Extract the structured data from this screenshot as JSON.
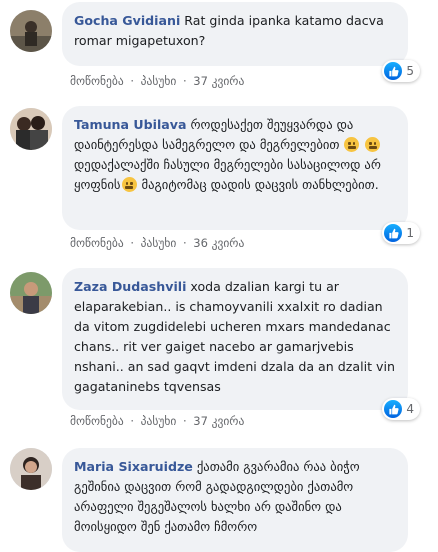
{
  "comments": [
    {
      "author": "Gocha Gvidiani",
      "text": "Rat ginda ipanka katamo dacva romar migapetuxon?",
      "like": "მოწონება",
      "reply": "პასუხი",
      "time": "37 კვირა",
      "reactions": "5"
    },
    {
      "author": "Tamuna Ubilava",
      "segments": [
        "როდესაქეთ შეუყვარდა და დაინტერესდა სამეგრელო და მეგრელებით",
        "დედაქალაქში ჩასული მეგრელები სასაცილოდ არ ყოფნის",
        "მაგიტომაც დადის დაცვის თანხლებით."
      ],
      "like": "მოწონება",
      "reply": "პასუხი",
      "time": "36 კვირა",
      "reactions": "1"
    },
    {
      "author": "Zaza Dudashvili",
      "text": "xoda dzalian kargi tu ar elaparakebian.. is chamoyvanili xxalxit ro dadian da vitom zugdidelebi ucheren mxars mandedanac chans.. rit ver gaiget nacebo ar gamarjvebis nshani.. an sad gaqvt imdeni dzala da an dzalit vin gagataninebs tqvensas",
      "like": "მოწონება",
      "reply": "პასუხი",
      "time": "37 კვირა",
      "reactions": "4"
    },
    {
      "author": "Maria Sixaruidze",
      "text": "ქათამი გვარამია რაა ბიჭო გეშინია დაცვით რომ გადადგილდები ქათამო არაფელი შეგეშალოს ხალხი არ დაშინო და მოისყიდო შენ ქათამო ჩმორო"
    }
  ],
  "colors": {
    "author": "#385898",
    "bubble": "#f0f2f5",
    "meta": "#65676b",
    "like": "#1877f2"
  },
  "icons": {
    "reaction": "like-icon",
    "emoji": "grinning-sweat-emoji"
  }
}
